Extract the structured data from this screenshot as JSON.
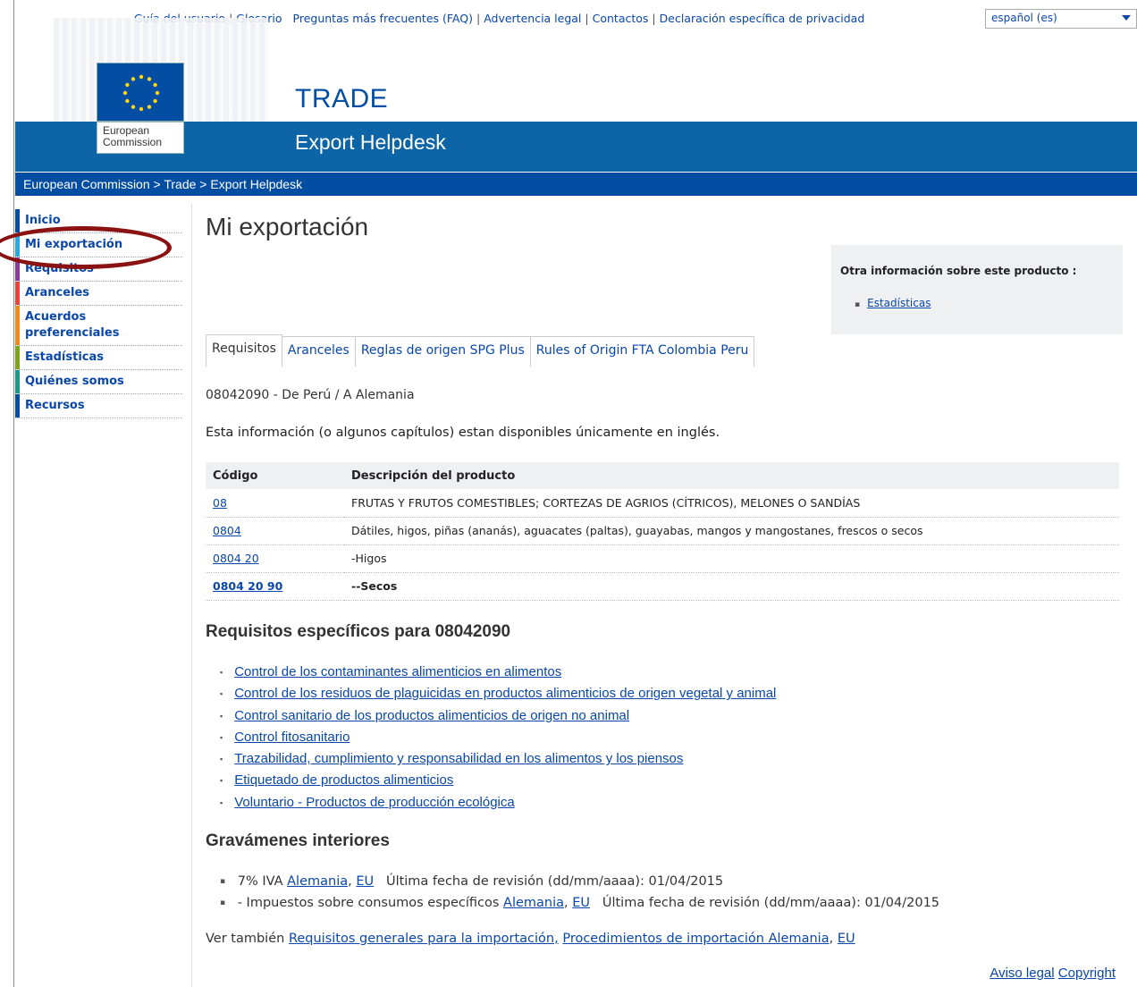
{
  "top_links": [
    "Guía del usuario",
    "Glosario",
    "Preguntas más frecuentes (FAQ)",
    "Advertencia legal",
    "Contactos",
    "Declaración específica de privacidad"
  ],
  "language": "español (es)",
  "logo": {
    "line1": "European",
    "line2": "Commission"
  },
  "site": {
    "title": "TRADE",
    "subtitle": "Export Helpdesk"
  },
  "breadcrumb": [
    "European Commission",
    "Trade",
    "Export Helpdesk"
  ],
  "breadcrumb_sep": ">",
  "sidebar": [
    {
      "label": "Inicio",
      "color": "#034ea2"
    },
    {
      "label": "Mi exportación",
      "color": "#29a9e0"
    },
    {
      "label": "Requisitos",
      "color": "#8b3a9a"
    },
    {
      "label": "Aranceles",
      "color": "#e8443a"
    },
    {
      "label": "Acuerdos preferenciales",
      "color": "#f08a1c"
    },
    {
      "label": "Estadísticas",
      "color": "#7aa51a"
    },
    {
      "label": "Quiénes somos",
      "color": "#1b9a8a"
    },
    {
      "label": "Recursos",
      "color": "#034ea2"
    }
  ],
  "page_title": "Mi exportación",
  "info_box": {
    "title": "Otra información sobre este producto :",
    "links": [
      "Estadísticas"
    ]
  },
  "tabs": [
    "Requisitos",
    "Aranceles",
    "Reglas de origen SPG Plus",
    "Rules of Origin FTA Colombia Peru"
  ],
  "origin_line": "08042090 - De Perú / A Alemania",
  "note": "Esta información (o algunos capítulos) estan disponibles únicamente en inglés.",
  "table": {
    "headers": [
      "Código",
      "Descripción del producto"
    ],
    "rows": [
      {
        "code": "08",
        "desc": "FRUTAS Y FRUTOS COMESTIBLES; CORTEZAS DE AGRIOS (CÍTRICOS), MELONES O SANDÍAS"
      },
      {
        "code": "0804",
        "desc": "Dátiles, higos, piñas (ananás), aguacates (paltas), guayabas, mangos y mangostanes, frescos o secos"
      },
      {
        "code": "0804 20",
        "desc": "-Higos"
      },
      {
        "code": "0804 20 90",
        "desc": "--Secos"
      }
    ]
  },
  "requirements": {
    "title": "Requisitos específicos para 08042090",
    "items": [
      "Control de los contaminantes alimenticios en alimentos",
      "Control de los residuos de plaguicidas en productos alimenticios de origen vegetal y animal",
      "Control sanitario de los productos alimenticios de origen no animal",
      "Control fitosanitario",
      "Trazabilidad, cumplimiento y responsabilidad en los alimentos y los piensos",
      "Etiquetado de productos alimenticios",
      "Voluntario - Productos de producción ecológica"
    ]
  },
  "taxes": {
    "title": "Gravámenes interiores",
    "items": [
      {
        "prefix": "7% IVA",
        "link1": "Alemania",
        "link2": "EU",
        "date_text": "Última fecha de revisión (dd/mm/aaaa): 01/04/2015"
      },
      {
        "prefix": "- Impuestos sobre consumos específicos",
        "link1": "Alemania",
        "link2": "EU",
        "date_text": "Última fecha de revisión (dd/mm/aaaa): 01/04/2015"
      }
    ]
  },
  "see_also": {
    "prefix": "Ver también",
    "link1": "Requisitos generales para la importación,",
    "link2": "Procedimientos de importación Alemania",
    "link3": "EU"
  },
  "footer": {
    "legal": "Aviso legal",
    "copyright": "Copyright"
  },
  "colors": {
    "brand_blue": "#034ea2",
    "band_blue": "#0d65a8",
    "link": "#0a47a9",
    "highlight_oval": "#8b1212"
  }
}
